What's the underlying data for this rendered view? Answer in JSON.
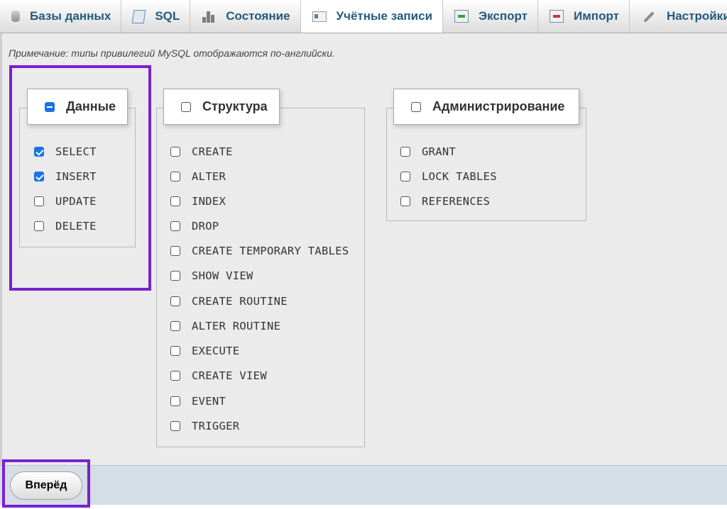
{
  "tabs": [
    {
      "label": "Базы данных",
      "icon": "database-icon"
    },
    {
      "label": "SQL",
      "icon": "sql-icon"
    },
    {
      "label": "Состояние",
      "icon": "status-icon"
    },
    {
      "label": "Учётные записи",
      "icon": "user-accounts-icon",
      "active": true
    },
    {
      "label": "Экспорт",
      "icon": "export-icon"
    },
    {
      "label": "Импорт",
      "icon": "import-icon"
    },
    {
      "label": "Настройки",
      "icon": "wrench-icon"
    }
  ],
  "note": "Примечание: типы привилегий MySQL отображаются по-английски.",
  "groups": {
    "data": {
      "title": "Данные",
      "state": "indeterminate",
      "items": [
        {
          "label": "SELECT",
          "checked": true
        },
        {
          "label": "INSERT",
          "checked": true
        },
        {
          "label": "UPDATE",
          "checked": false
        },
        {
          "label": "DELETE",
          "checked": false
        }
      ]
    },
    "structure": {
      "title": "Структура",
      "state": "unchecked",
      "items": [
        {
          "label": "CREATE",
          "checked": false
        },
        {
          "label": "ALTER",
          "checked": false
        },
        {
          "label": "INDEX",
          "checked": false
        },
        {
          "label": "DROP",
          "checked": false
        },
        {
          "label": "CREATE TEMPORARY TABLES",
          "checked": false
        },
        {
          "label": "SHOW VIEW",
          "checked": false
        },
        {
          "label": "CREATE ROUTINE",
          "checked": false
        },
        {
          "label": "ALTER ROUTINE",
          "checked": false
        },
        {
          "label": "EXECUTE",
          "checked": false
        },
        {
          "label": "CREATE VIEW",
          "checked": false
        },
        {
          "label": "EVENT",
          "checked": false
        },
        {
          "label": "TRIGGER",
          "checked": false
        }
      ]
    },
    "admin": {
      "title": "Администрирование",
      "state": "unchecked",
      "items": [
        {
          "label": "GRANT",
          "checked": false
        },
        {
          "label": "LOCK TABLES",
          "checked": false
        },
        {
          "label": "REFERENCES",
          "checked": false
        }
      ]
    }
  },
  "buttons": {
    "next": "Вперёд"
  },
  "colors": {
    "highlight": "#7a1fd1",
    "checkbox": "#1a73e8",
    "tab_text": "#235a81"
  }
}
